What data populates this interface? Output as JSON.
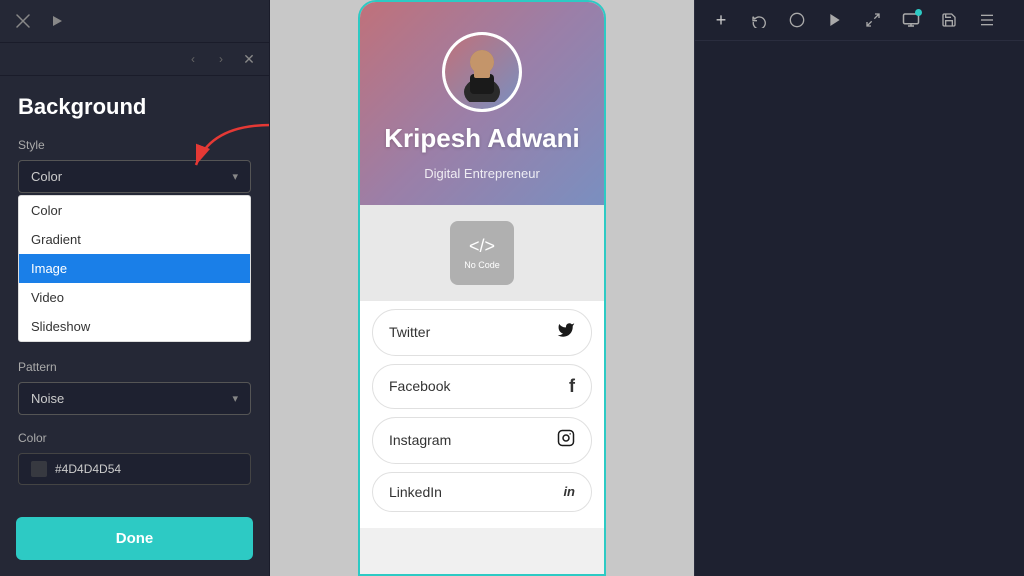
{
  "leftPanel": {
    "title": "Background",
    "styleSection": {
      "label": "Style",
      "selectedValue": "Color",
      "options": [
        "Color",
        "Gradient",
        "Image",
        "Video",
        "Slideshow"
      ],
      "activeOption": "Image"
    },
    "patternSection": {
      "label": "Pattern",
      "selectedValue": "Noise"
    },
    "colorSection": {
      "label": "Color",
      "value": "#4D4D4D54"
    },
    "doneButton": "Done"
  },
  "preview": {
    "name": "Kripesh Adwani",
    "subtitle": "Digital Entrepreneur",
    "noCodeLabel": "No Code",
    "links": [
      {
        "label": "Twitter",
        "icon": "🐦"
      },
      {
        "label": "Facebook",
        "icon": "f"
      },
      {
        "label": "Instagram",
        "icon": "📷"
      },
      {
        "label": "LinkedIn",
        "icon": "in"
      }
    ]
  },
  "topBar": {
    "icons": [
      "✕",
      "▷",
      "◁",
      "▷",
      "⬤",
      "↩",
      "↻",
      "▷",
      "⤢",
      "🖥",
      "⬛",
      "☰"
    ]
  }
}
